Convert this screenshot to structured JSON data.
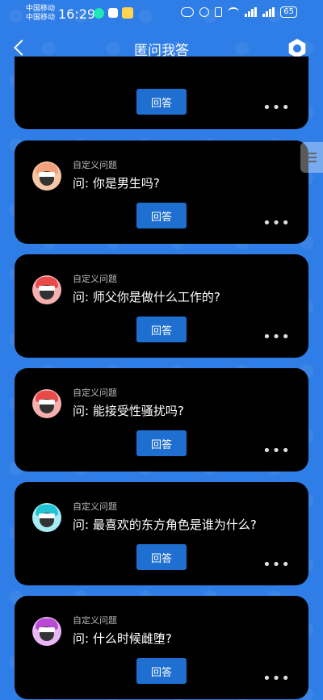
{
  "status_bar": {
    "carrier1": "中国移动",
    "carrier2": "中国移动",
    "time": "16:29",
    "battery": "65"
  },
  "header": {
    "title": "匿问我答"
  },
  "colors": {
    "background": "#2f7de6",
    "card": "#000000",
    "answer_button": "#1e6fd0"
  },
  "cards": [
    {
      "label": "",
      "question": "",
      "answer_label": "回答",
      "more": "•••"
    },
    {
      "label": "自定义问题",
      "question": "问: 你是男生吗?",
      "answer_label": "回答",
      "more": "•••",
      "avatar_color": "#f2a27a"
    },
    {
      "label": "自定义问题",
      "question": "问: 师父你是做什么工作的?",
      "answer_label": "回答",
      "more": "•••",
      "avatar_color": "#e84a4a"
    },
    {
      "label": "自定义问题",
      "question": "问: 能接受性骚扰吗?",
      "answer_label": "回答",
      "more": "•••",
      "avatar_color": "#e84a4a"
    },
    {
      "label": "自定义问题",
      "question": "问: 最喜欢的东方角色是谁为什么?",
      "answer_label": "回答",
      "more": "•••",
      "avatar_color": "#23c3d6"
    },
    {
      "label": "自定义问题",
      "question": "问: 什么时候雌堕?",
      "answer_label": "回答",
      "more": "•••",
      "avatar_color": "#b94ad6"
    }
  ]
}
